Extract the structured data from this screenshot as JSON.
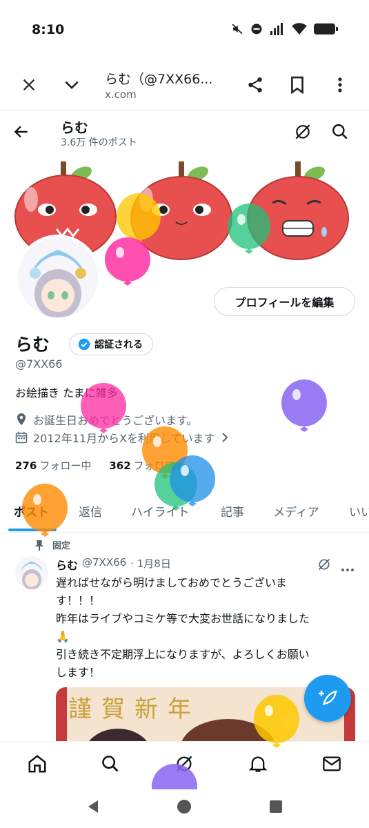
{
  "status": {
    "time": "8:10"
  },
  "browser": {
    "title": "らむ（@7XX66...",
    "url": "x.com"
  },
  "header": {
    "name": "らむ",
    "post_count": "3.6万 件のポスト"
  },
  "profile": {
    "edit_label": "プロフィールを編集",
    "name": "らむ",
    "verify_label": "認証される",
    "handle": "@7XX66",
    "bio": "お絵描き たまに雑多",
    "birthday": "お誕生日おめでとうございます。",
    "joined": "2012年11月からXを利用しています",
    "following_count": "276",
    "following_label": "フォロー中",
    "followers_count": "362",
    "followers_label": "フォロワー"
  },
  "tabs": [
    "ポスト",
    "返信",
    "ハイライト",
    "記事",
    "メディア",
    "いいね"
  ],
  "post": {
    "pinned_label": "固定",
    "name": "らむ",
    "handle": "@7XX66",
    "date": "· 1月8日",
    "text": "遅ればせながら明けましておめでとうございま\nす！！！\n昨年はライブやコミケ等で大変お世話になりました\n🙏\n引き続き不定期浮上になりますが、よろしくお願い\nします！",
    "image_text": "謹賀新年"
  },
  "icons": {
    "close": "close-icon",
    "chevron": "chevron-down-icon",
    "share": "share-icon",
    "bookmark": "bookmark-icon",
    "more": "more-vert-icon",
    "back": "back-arrow-icon",
    "grok": "grok-icon",
    "search": "search-icon",
    "location": "location-icon",
    "calendar": "calendar-icon",
    "pin": "pin-icon",
    "home": "home-icon",
    "bell": "bell-icon",
    "mail": "mail-icon",
    "compose": "compose-icon"
  },
  "colors": {
    "accent": "#1d9bf0",
    "text": "#0f1419",
    "secondary": "#536471"
  }
}
